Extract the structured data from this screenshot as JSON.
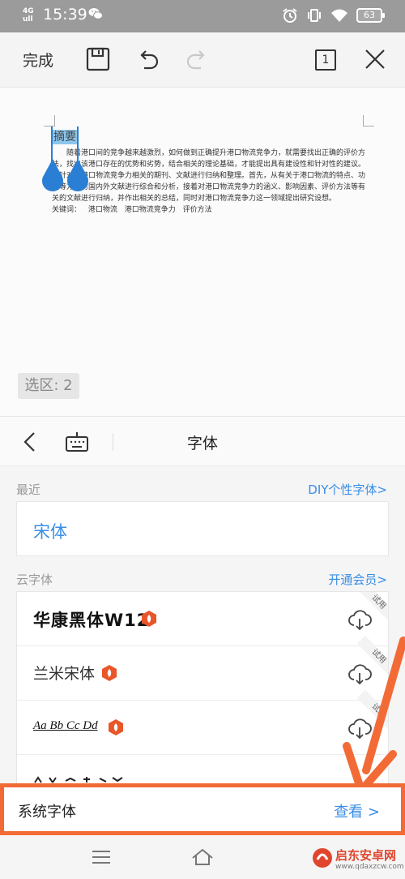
{
  "status_bar": {
    "network": "4G",
    "network_sub": "ull",
    "time": "15:39",
    "battery": "63"
  },
  "toolbar": {
    "done_label": "完成",
    "page_number": "1"
  },
  "document": {
    "title": "摘要",
    "body": "随着港口间的竞争越来越激烈，如何做到正确提升港口物流竞争力，就需要找出正确的评价方法，找出该港口存在的优势和劣势，结合相关的理论基础，才能提出具有建设性和针对性的建议。将针对与港口物流竞争力相关的期刊、文献进行归纳和整理。首先，从有关于港口物流的特点、功能等方面对国内外文献进行综合和分析，接着对港口物流竞争力的涵义、影响因素、评价方法等有关的文献进行归纳，并作出相关的总结，同时对港口物流竞争力这一领域提出研究设想。",
    "keywords_label": "关键词：",
    "keywords": [
      "港口物流",
      "港口物流竞争力",
      "评价方法"
    ]
  },
  "selection_badge": "选区: 2",
  "font_panel": {
    "title": "字体",
    "recent_label": "最近",
    "diy_link": "DIY个性字体>",
    "recent_font": "宋体",
    "cloud_label": "云字体",
    "vip_link": "开通会员>",
    "cloud_fonts": [
      {
        "name": "华康黑体W12",
        "trial": "试用"
      },
      {
        "name": "兰米宋体",
        "trial": "试用"
      },
      {
        "name": "Aa Bb Cc Dd",
        "trial": "试用"
      }
    ]
  },
  "system_fonts": {
    "label": "系统字体",
    "view_label": "查看 >"
  },
  "watermark": {
    "title": "启东安卓网",
    "url": "www.qdaxzcw.com"
  },
  "colors": {
    "accent_blue": "#3a8ee6",
    "highlight_orange": "#f26b36",
    "selection_blue": "#8cc6ec"
  }
}
